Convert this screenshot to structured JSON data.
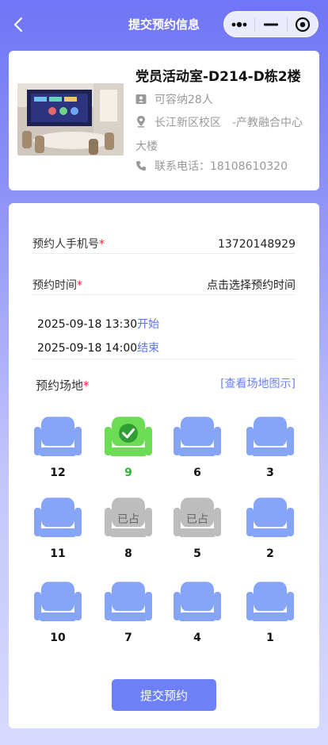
{
  "nav": {
    "title": "提交预约信息",
    "back_icon": "chevron-left-icon",
    "capsule_icons": [
      "more-dots-icon",
      "minimize-icon",
      "close-target-icon"
    ]
  },
  "room": {
    "name": "党员活动室-D214-D栋2楼",
    "capacity": "可容纳28人",
    "address": "长江新区校区　-产教融合中心大楼",
    "phone": "联系电话：18108610320",
    "icons": {
      "capacity": "person-card-icon",
      "address": "location-pin-icon",
      "phone": "phone-icon"
    }
  },
  "form": {
    "phone_label": "预约人手机号",
    "phone_value": "13720148929",
    "time_label": "预约时间",
    "time_value": "点击选择预约时间",
    "required_mark": "*",
    "start_time": "2025-09-18 13:30",
    "start_tag": "开始",
    "end_time": "2025-09-18 14:00",
    "end_tag": "结束",
    "venue_label": "预约场地",
    "venue_link": "[查看场地图示]",
    "submit_label": "提交预约"
  },
  "colors": {
    "seat_free": "#86a5f8",
    "seat_selected": "#6ddc55",
    "seat_occupied": "#bdbdbd",
    "accent": "#6d80f5"
  },
  "seats": [
    {
      "number": "12",
      "status": "free"
    },
    {
      "number": "9",
      "status": "selected"
    },
    {
      "number": "6",
      "status": "free"
    },
    {
      "number": "3",
      "status": "free"
    },
    {
      "number": "11",
      "status": "free"
    },
    {
      "number": "8",
      "status": "occupied",
      "label": "已占"
    },
    {
      "number": "5",
      "status": "occupied",
      "label": "已占"
    },
    {
      "number": "2",
      "status": "free"
    },
    {
      "number": "10",
      "status": "free"
    },
    {
      "number": "7",
      "status": "free"
    },
    {
      "number": "4",
      "status": "free"
    },
    {
      "number": "1",
      "status": "free"
    }
  ]
}
